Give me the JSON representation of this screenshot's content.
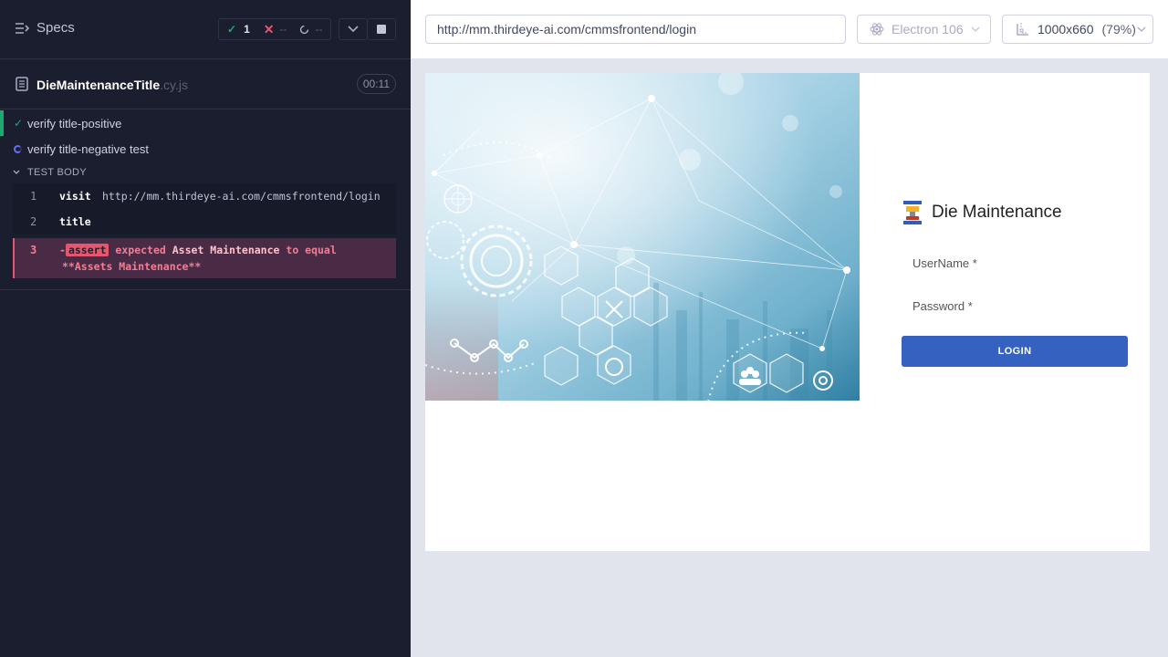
{
  "runner": {
    "specs_label": "Specs",
    "stats": {
      "passed": "1",
      "failed": "--",
      "pending": "--"
    },
    "spec": {
      "name": "DieMaintenanceTitle",
      "ext": ".cy.js",
      "duration": "00:11"
    },
    "tests": [
      {
        "title": "verify title-positive",
        "state": "passed"
      },
      {
        "title": "verify title-negative test",
        "state": "running"
      }
    ],
    "test_body_label": "TEST BODY",
    "commands": [
      {
        "num": "1",
        "name": "visit",
        "message": "http://mm.thirdeye-ai.com/cmmsfrontend/login"
      },
      {
        "num": "2",
        "name": "title",
        "message": ""
      },
      {
        "num": "3",
        "name": "assert",
        "prefix": "-",
        "msg_expected": "expected",
        "msg_value": "Asset Maintenance",
        "msg_to_equal": "to equal",
        "msg_actual": "**Assets Maintenance**"
      }
    ]
  },
  "aut": {
    "url": "http://mm.thirdeye-ai.com/cmmsfrontend/login",
    "browser": "Electron 106",
    "viewport": "1000x660",
    "scale": "(79%)",
    "app": {
      "brand_name": "Die Maintenance",
      "username_label": "UserName *",
      "password_label": "Password *",
      "login_button": "LOGIN"
    }
  },
  "colors": {
    "runner_bg": "#1b1e2e",
    "pass": "#1fa971",
    "fail": "#e45770",
    "login_button": "#3562c1"
  }
}
